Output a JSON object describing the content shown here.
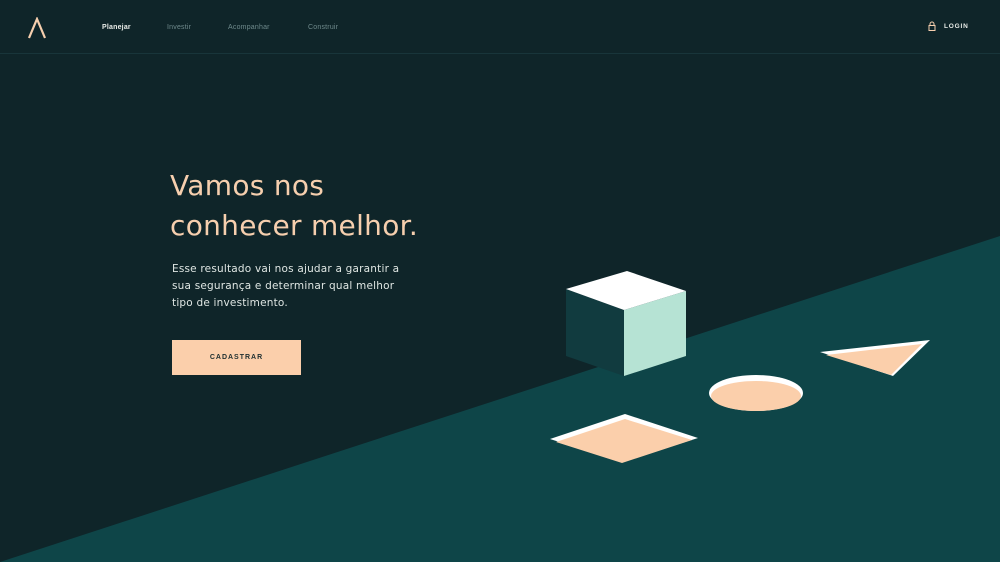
{
  "brand": {
    "logo_icon": "chevron-up-logo-icon"
  },
  "nav": {
    "items": [
      {
        "label": "Planejar",
        "active": true
      },
      {
        "label": "Investir",
        "active": false
      },
      {
        "label": "Acompanhar",
        "active": false
      },
      {
        "label": "Construir",
        "active": false
      }
    ]
  },
  "header": {
    "login_label": "LOGIN",
    "login_icon": "lock-icon"
  },
  "hero": {
    "title_line1": "Vamos nos",
    "title_line2": "conhecer melhor.",
    "text_line1": "Esse resultado vai nos ajudar a garantir a",
    "text_line2": "sua segurança e determinar qual melhor",
    "text_line3": "tipo de investimento.",
    "cta_label": "CADASTRAR"
  },
  "colors": {
    "background": "#0f2529",
    "plane": "#0e4548",
    "accent_peach": "#fbcfab",
    "mint": "#b6e3d4",
    "white": "#ffffff"
  },
  "illustration": {
    "shapes": [
      "cube",
      "triangle",
      "ellipse",
      "diamond"
    ]
  }
}
